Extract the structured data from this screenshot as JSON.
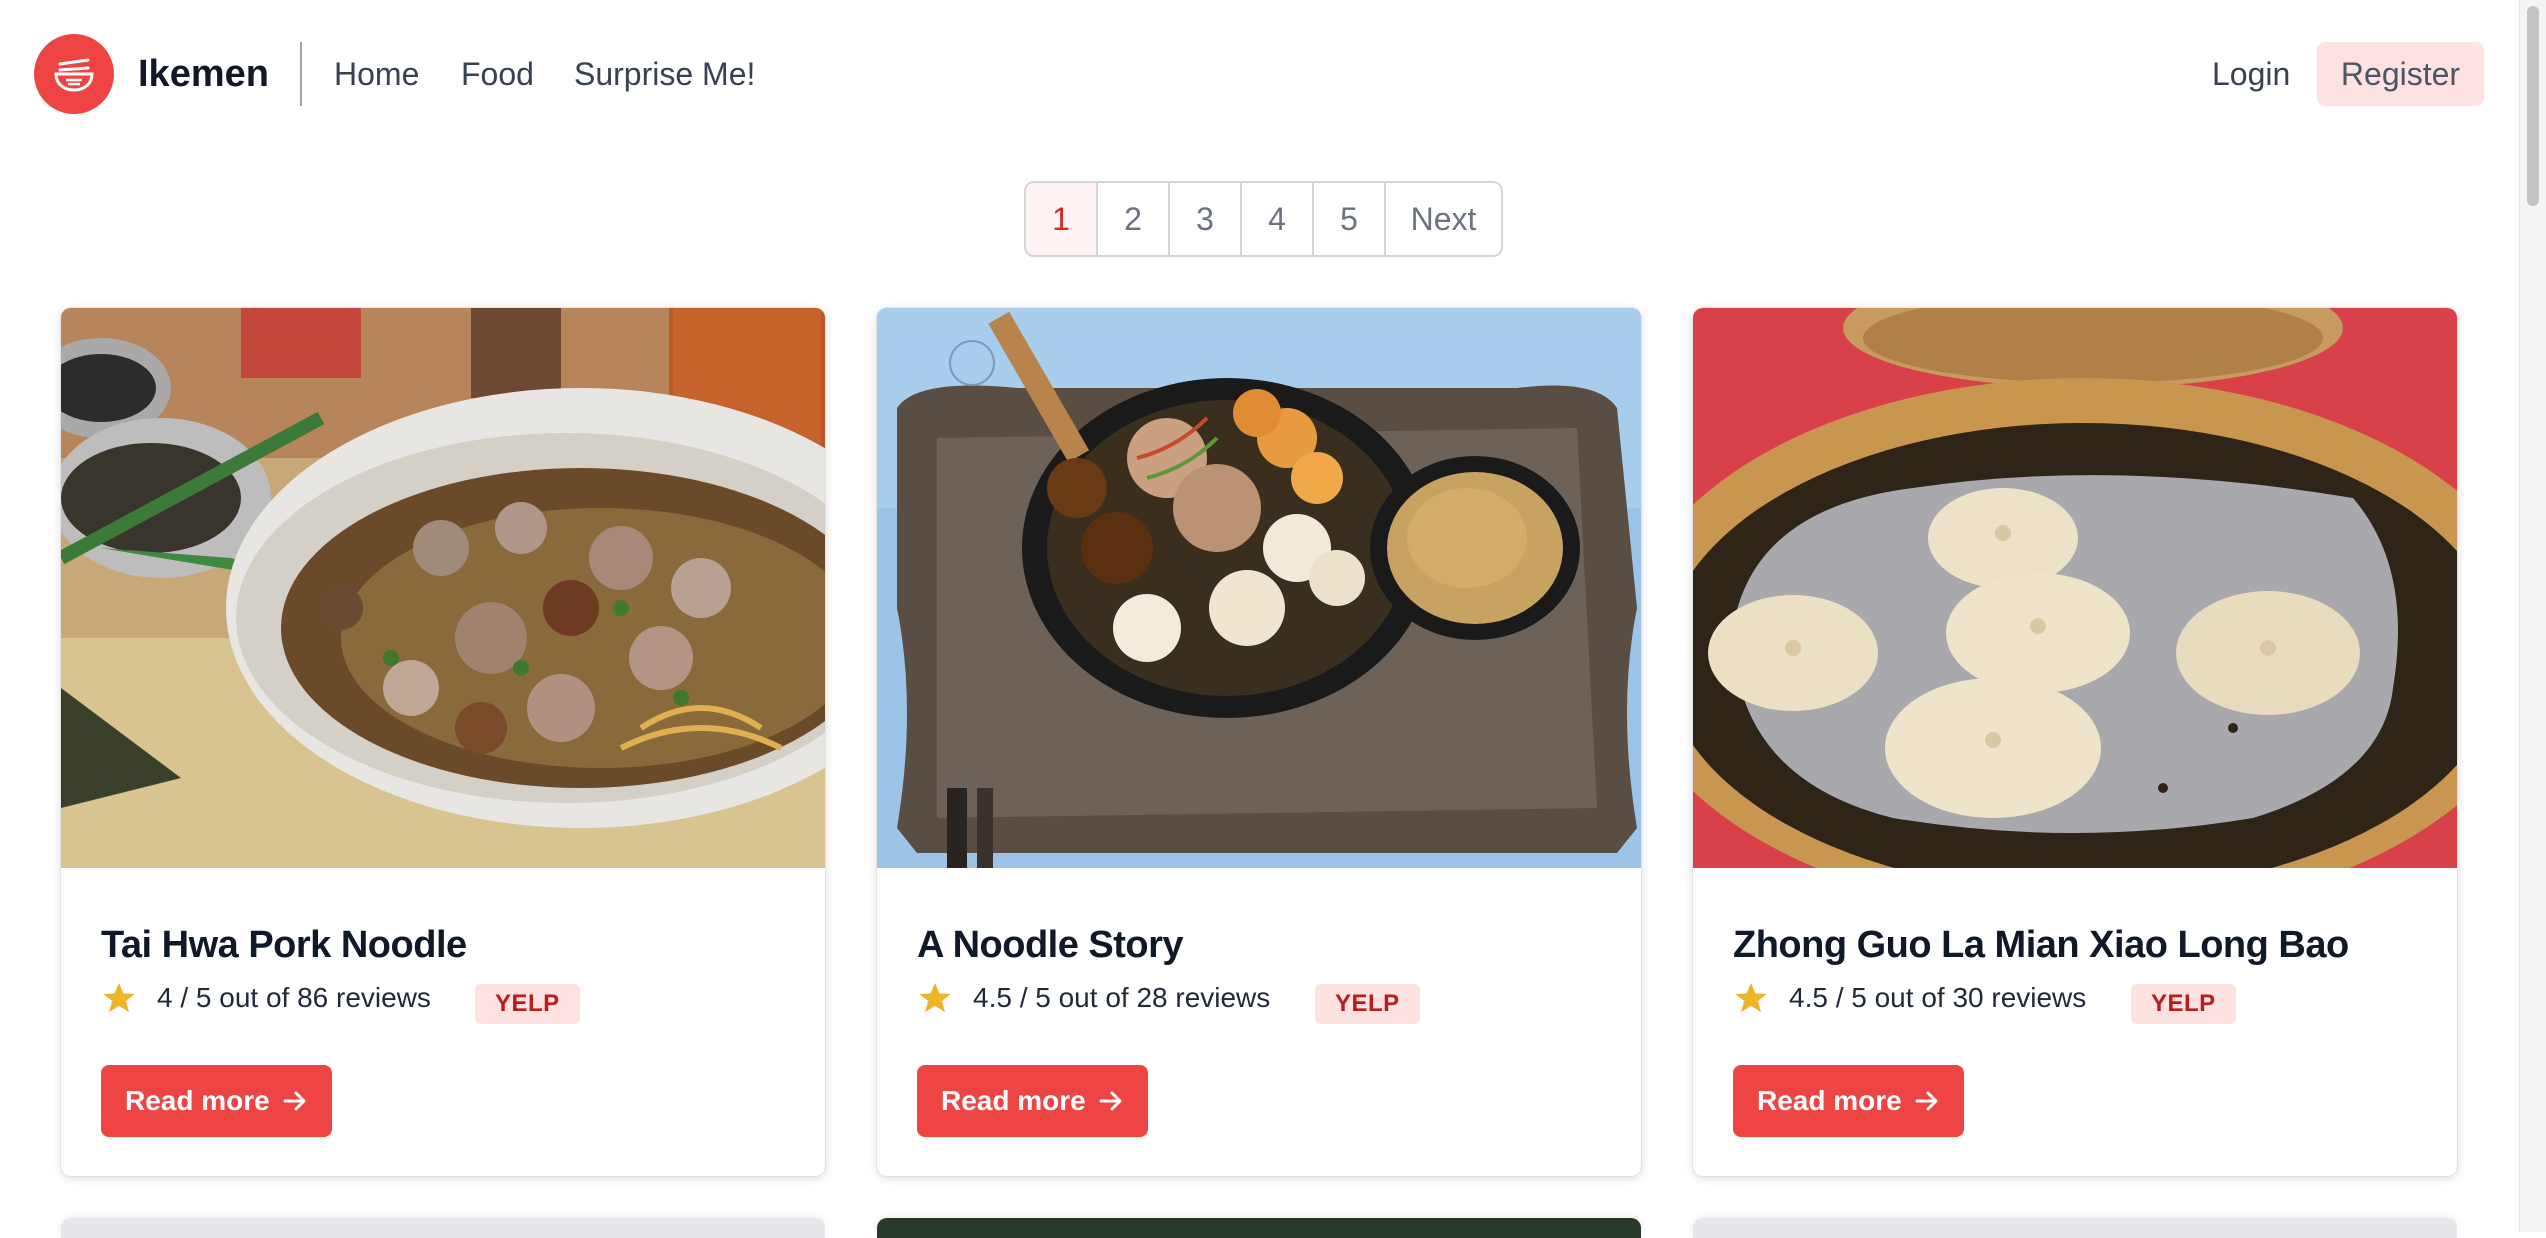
{
  "header": {
    "brand": "Ikemen",
    "nav": [
      {
        "label": "Home"
      },
      {
        "label": "Food"
      },
      {
        "label": "Surprise Me!"
      }
    ],
    "login_label": "Login",
    "register_label": "Register",
    "accent_color": "#ef4444"
  },
  "pagination": {
    "pages": [
      "1",
      "2",
      "3",
      "4",
      "5"
    ],
    "current_page": "1",
    "next_label": "Next"
  },
  "cards": [
    {
      "title": "Tai Hwa Pork Noodle",
      "rating_text": "4 / 5 out of 86 reviews",
      "source_badge": "YELP",
      "read_more_label": "Read more",
      "image": "bowl of minced pork noodles with meatballs"
    },
    {
      "title": "A Noodle Story",
      "rating_text": "4.5 / 5 out of 28 reviews",
      "source_badge": "YELP",
      "read_more_label": "Read more",
      "image": "ramen bowl with wontons, potato crisps and soup on tray"
    },
    {
      "title": "Zhong Guo La Mian Xiao Long Bao",
      "rating_text": "4.5 / 5 out of 30 reviews",
      "source_badge": "YELP",
      "read_more_label": "Read more",
      "image": "xiao long bao dumplings in bamboo steamer"
    }
  ],
  "icons": {
    "logo": "noodle-bowl-icon",
    "rating": "star-icon",
    "read_more": "arrow-right-icon"
  }
}
